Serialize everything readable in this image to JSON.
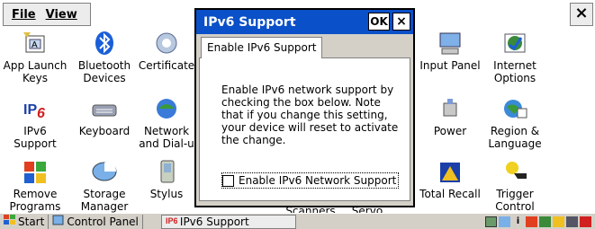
{
  "menu": {
    "file": "File",
    "view": "View",
    "close_glyph": "×"
  },
  "tiles": [
    {
      "label": "App Launch\nKeys",
      "icon": "app-launch-icon"
    },
    {
      "label": "Bluetooth\nDevices",
      "icon": "bluetooth-icon"
    },
    {
      "label": "Certificate",
      "icon": "certificate-icon"
    },
    {
      "label": "Input Panel",
      "icon": "input-panel-icon"
    },
    {
      "label": "Internet\nOptions",
      "icon": "internet-options-icon"
    },
    {
      "label": "IPv6\nSupport",
      "icon": "ipv6-icon"
    },
    {
      "label": "Keyboard",
      "icon": "keyboard-icon"
    },
    {
      "label": "Network\nand Dial-u",
      "icon": "network-icon"
    },
    {
      "label": "Power",
      "icon": "power-icon"
    },
    {
      "label": "Region &\nLanguage",
      "icon": "region-icon"
    },
    {
      "label": "Remove\nPrograms",
      "icon": "remove-programs-icon"
    },
    {
      "label": "Storage\nManager",
      "icon": "storage-icon"
    },
    {
      "label": "Stylus",
      "icon": "stylus-icon"
    },
    {
      "label": "Scanners",
      "icon": "scanners-icon"
    },
    {
      "label": "Servo",
      "icon": "servo-icon"
    },
    {
      "label": "Total Recall",
      "icon": "total-recall-icon"
    },
    {
      "label": "Trigger\nControl",
      "icon": "trigger-icon"
    }
  ],
  "dialog": {
    "title": "IPv6 Support",
    "ok_label": "OK",
    "close_glyph": "×",
    "tab_label": "Enable IPv6 Support",
    "description": "Enable IPv6 network support by checking the box below.  Note that if you change this setting, your device will reset to activate the change.",
    "checkbox_label": "Enable IPv6 Network Support",
    "checkbox_checked": false
  },
  "taskbar": {
    "start_label": "Start",
    "control_panel_label": "Control Panel",
    "active_task_label": "IPv6 Support"
  },
  "colors": {
    "title_bar": "#0a50c8",
    "dialog_bg": "#d4d0c8"
  }
}
